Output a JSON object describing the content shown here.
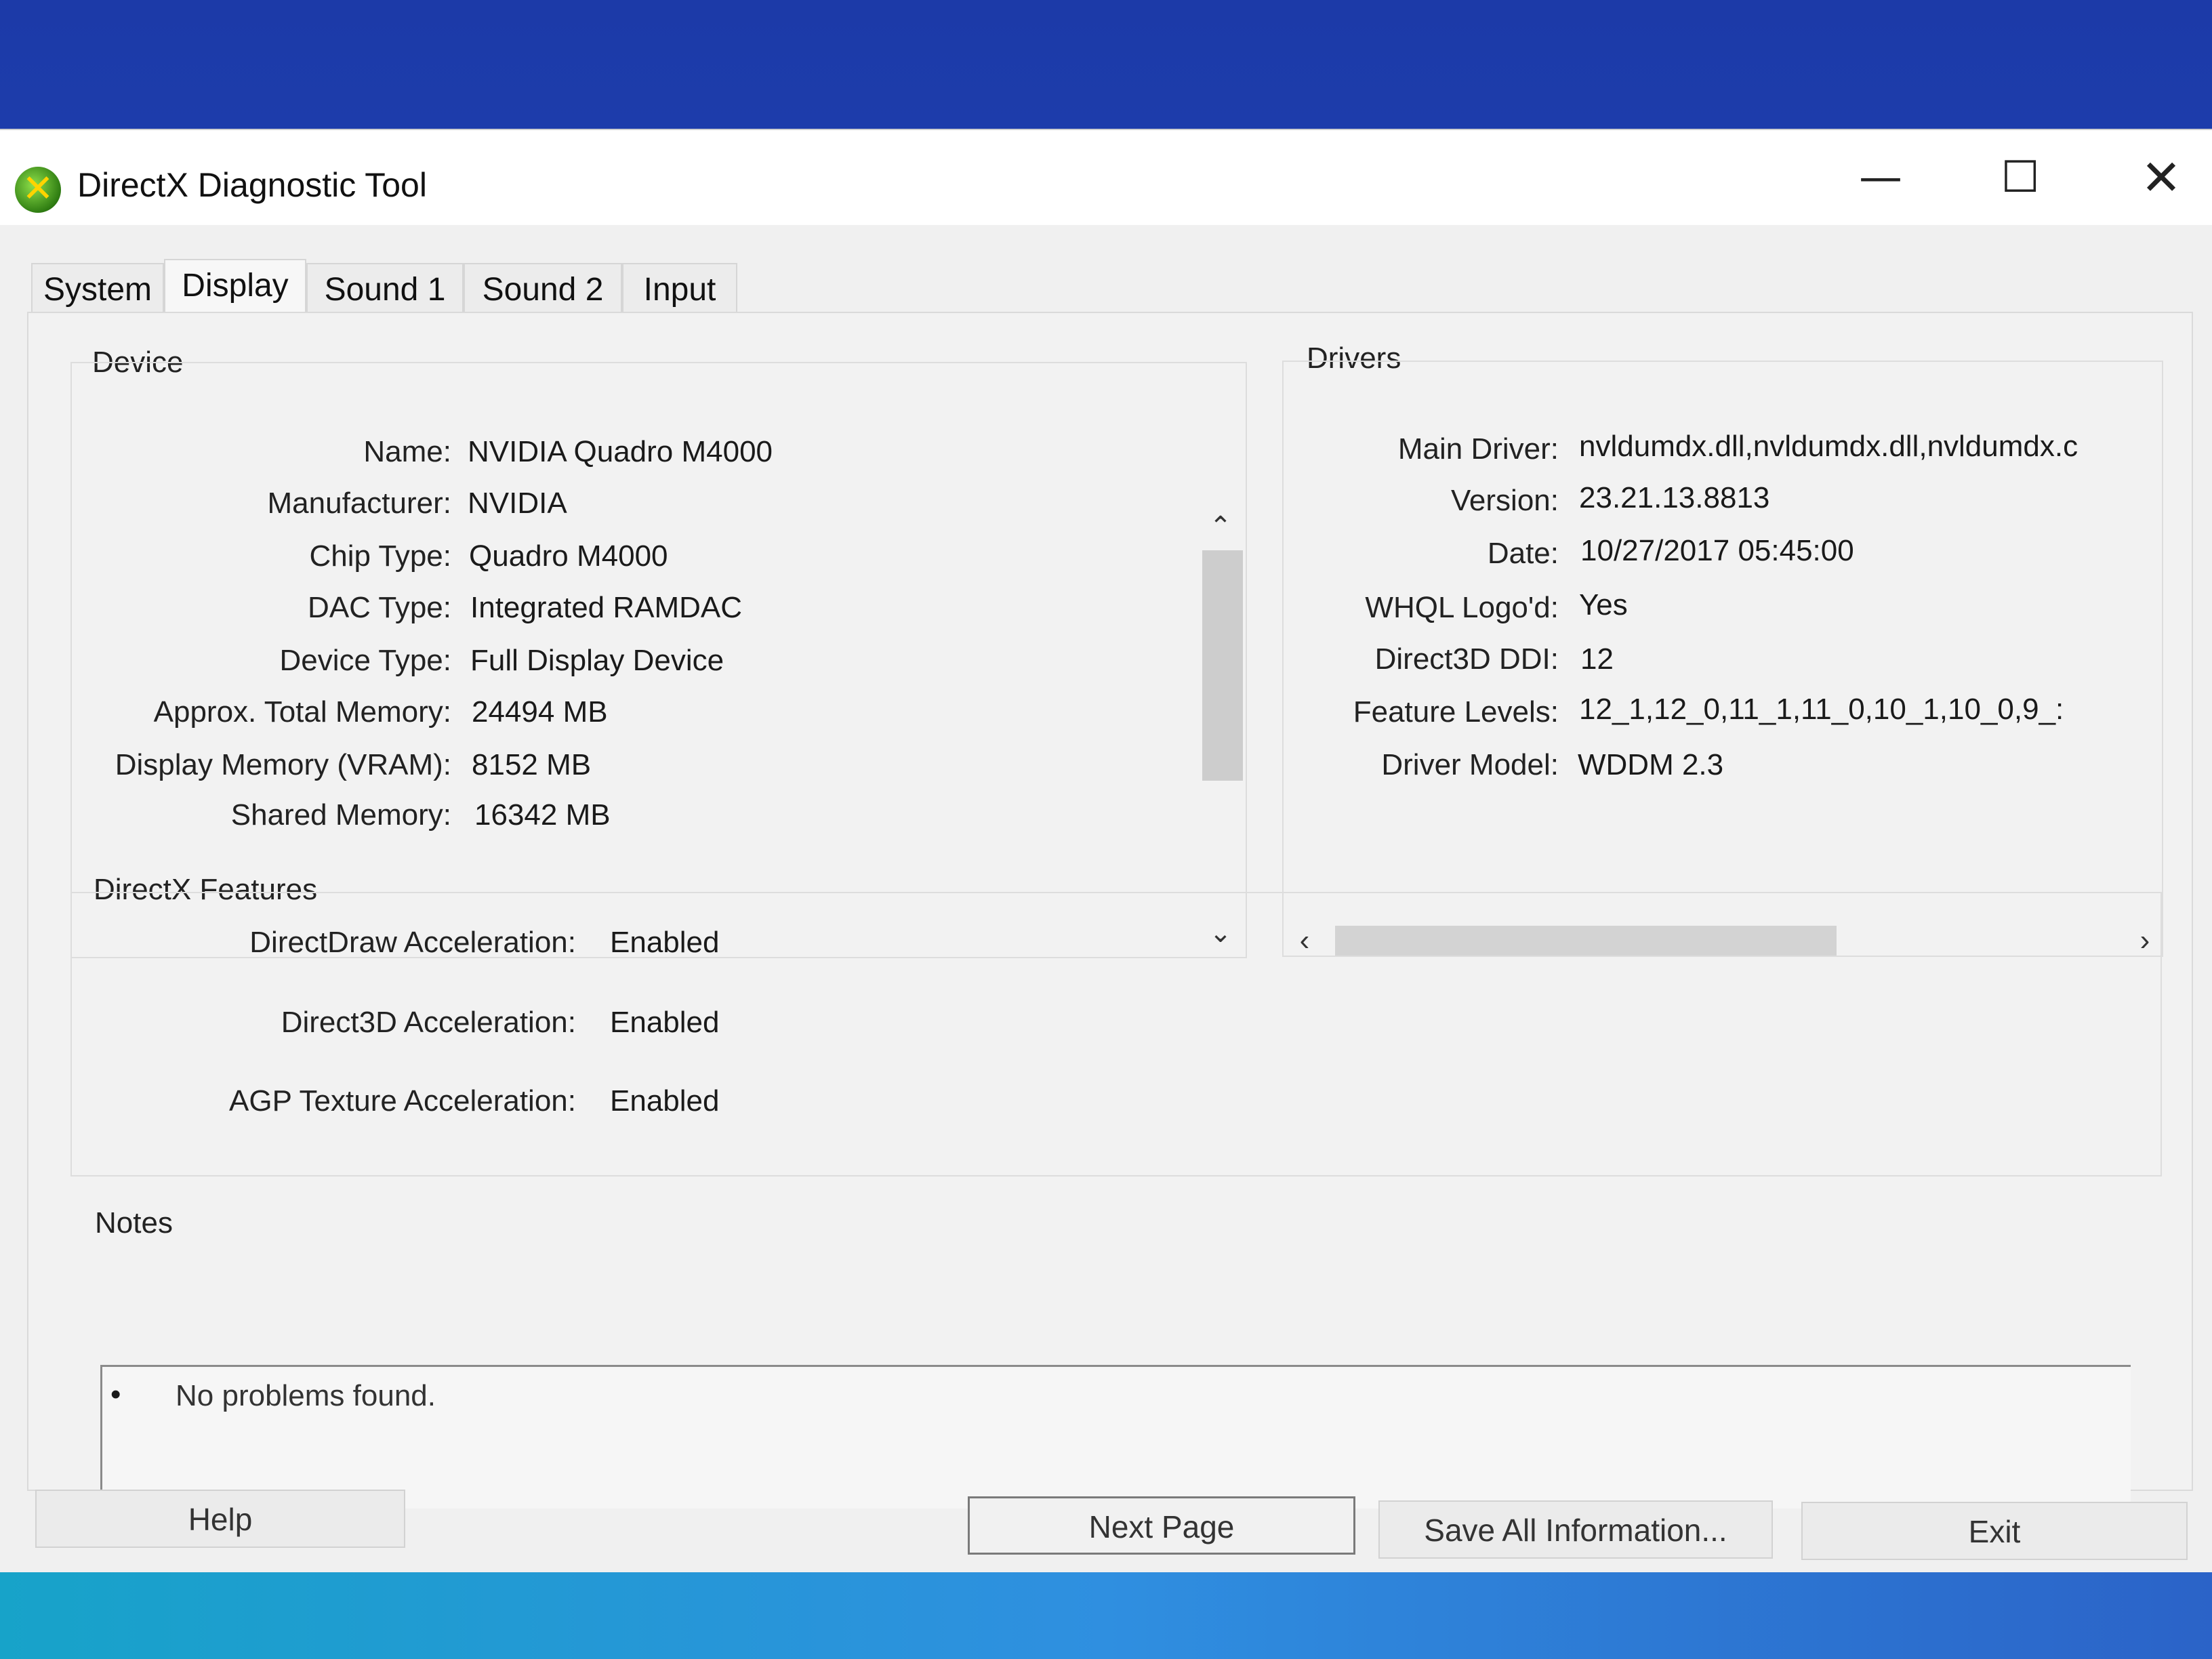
{
  "window": {
    "title": "DirectX Diagnostic Tool",
    "minimize_glyph": "—",
    "maximize_glyph": "☐",
    "close_glyph": "✕",
    "icon_glyph": "✕"
  },
  "tabs": [
    {
      "label": "System"
    },
    {
      "label": "Display",
      "active": true
    },
    {
      "label": "Sound 1"
    },
    {
      "label": "Sound 2"
    },
    {
      "label": "Input"
    }
  ],
  "device": {
    "title": "Device",
    "rows": [
      {
        "label": "Name:",
        "value": "NVIDIA Quadro M4000"
      },
      {
        "label": "Manufacturer:",
        "value": "NVIDIA"
      },
      {
        "label": "Chip Type:",
        "value": "Quadro M4000"
      },
      {
        "label": "DAC Type:",
        "value": "Integrated RAMDAC"
      },
      {
        "label": "Device Type:",
        "value": "Full Display Device"
      },
      {
        "label": "Approx. Total Memory:",
        "value": "24494 MB"
      },
      {
        "label": "Display Memory (VRAM):",
        "value": "8152 MB"
      },
      {
        "label": "Shared Memory:",
        "value": "16342 MB"
      }
    ],
    "scroll_up": "⌃",
    "scroll_down": "⌄"
  },
  "drivers": {
    "title": "Drivers",
    "rows": [
      {
        "label": "Main Driver:",
        "value": "nvldumdx.dll,nvldumdx.dll,nvldumdx.c"
      },
      {
        "label": "Version:",
        "value": "23.21.13.8813"
      },
      {
        "label": "Date:",
        "value": "10/27/2017 05:45:00"
      },
      {
        "label": "WHQL Logo'd:",
        "value": "Yes"
      },
      {
        "label": "Direct3D DDI:",
        "value": "12"
      },
      {
        "label": "Feature Levels:",
        "value": "12_1,12_0,11_1,11_0,10_1,10_0,9_:"
      },
      {
        "label": "Driver Model:",
        "value": "WDDM 2.3"
      }
    ],
    "scroll_left": "‹",
    "scroll_right": "›"
  },
  "directx_features": {
    "title": "DirectX Features",
    "rows": [
      {
        "label": "DirectDraw Acceleration:",
        "value": "Enabled"
      },
      {
        "label": "Direct3D Acceleration:",
        "value": "Enabled"
      },
      {
        "label": "AGP Texture Acceleration:",
        "value": "Enabled"
      }
    ]
  },
  "notes": {
    "title": "Notes",
    "bullet": "•",
    "items": [
      "No problems found."
    ]
  },
  "buttons": {
    "help": "Help",
    "next_page": "Next Page",
    "save_all": "Save All Information...",
    "exit": "Exit"
  }
}
